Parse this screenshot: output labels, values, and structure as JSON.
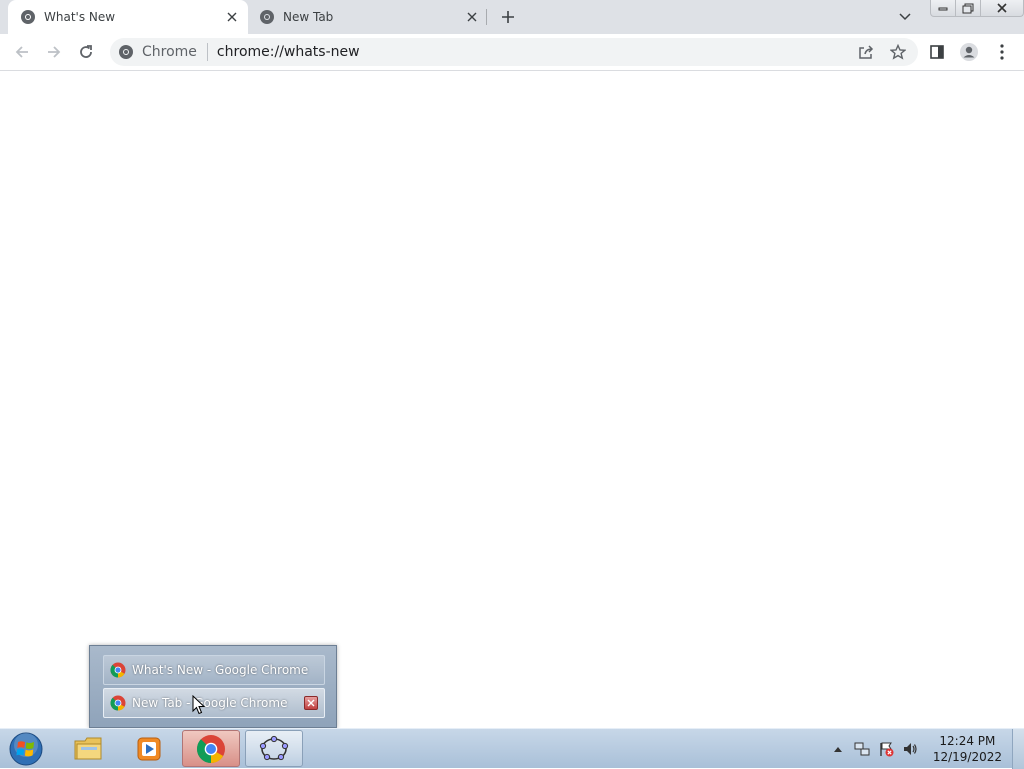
{
  "browser": {
    "tabs": [
      {
        "title": "What's New",
        "active": true
      },
      {
        "title": "New Tab",
        "active": false
      }
    ],
    "omnibox": {
      "site_chip": "Chrome",
      "url": "chrome://whats-new"
    }
  },
  "taskbar_popup": {
    "items": [
      {
        "label": "What's New - Google Chrome"
      },
      {
        "label": "New Tab - Google Chrome"
      }
    ]
  },
  "taskbar": {
    "apps": [
      "windows-explorer",
      "media-player",
      "google-chrome",
      "geogebra"
    ],
    "clock": {
      "time": "12:24 PM",
      "date": "12/19/2022"
    }
  },
  "colors": {
    "tabstrip": "#dee1e6",
    "omnibox": "#f1f3f4",
    "taskbar": "#b8cce0"
  }
}
